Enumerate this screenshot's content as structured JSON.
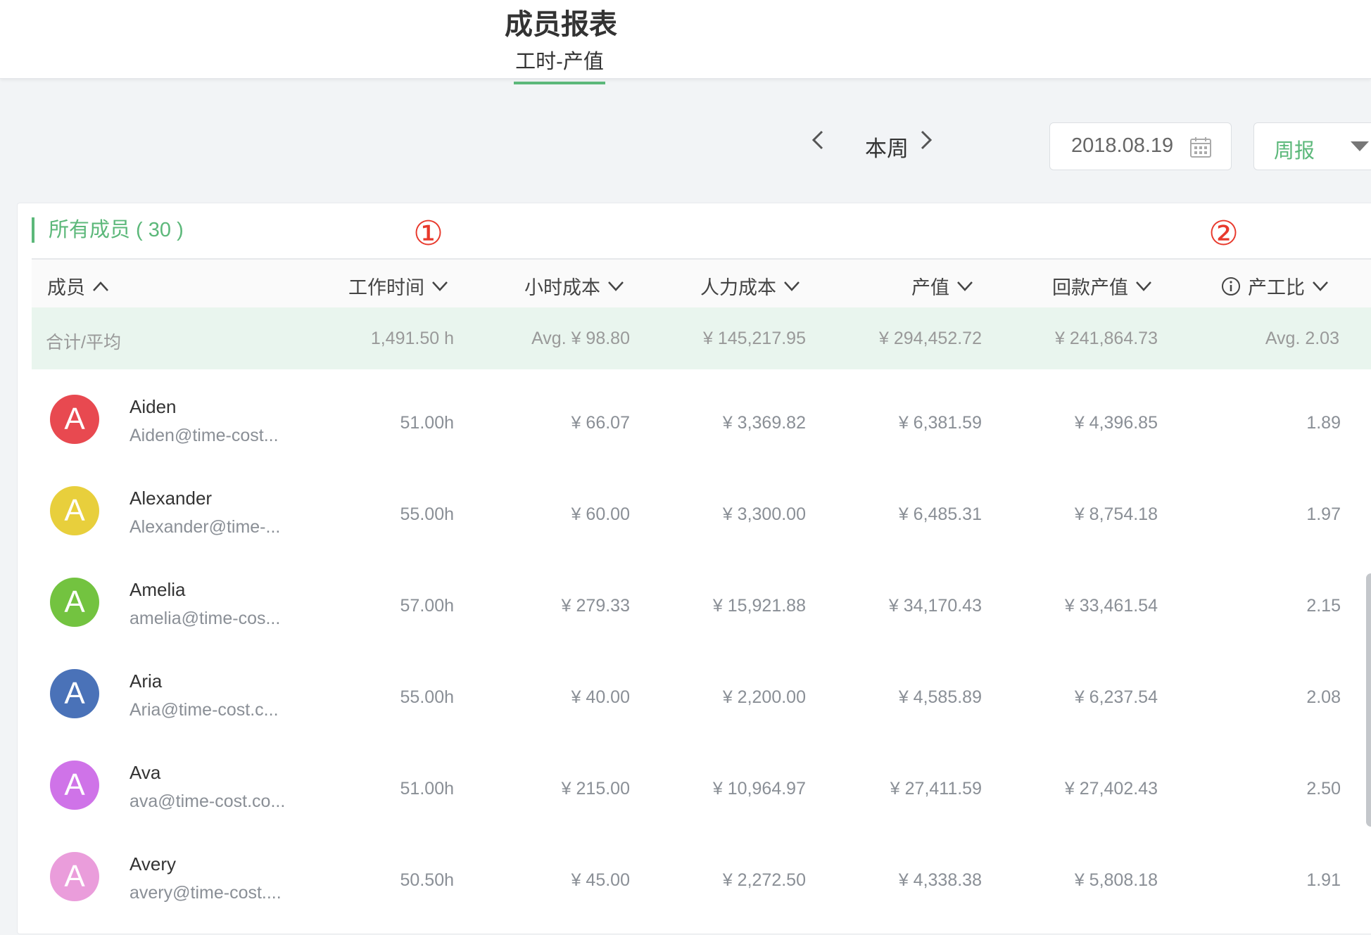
{
  "page": {
    "title": "成员报表",
    "tab": "工时-产值"
  },
  "toolbar": {
    "period": "本周",
    "date": "2018.08.19",
    "report_type": "周报"
  },
  "card": {
    "title": "所有成员 ( 30 )"
  },
  "annotations": [
    "①",
    "②"
  ],
  "columns": [
    "成员",
    "工作时间",
    "小时成本",
    "人力成本",
    "产值",
    "回款产值",
    "产工比"
  ],
  "summary": {
    "label": "合计/平均",
    "hours": "1,491.50 h",
    "hourly_cost": "Avg. ¥ 98.80",
    "labor_cost": "¥ 145,217.95",
    "output": "¥ 294,452.72",
    "collected_output": "¥ 241,864.73",
    "ratio": "Avg. 2.03"
  },
  "members": [
    {
      "initial": "A",
      "color": "#e84950",
      "name": "Aiden",
      "email": "Aiden@time-cost...",
      "hours": "51.00h",
      "hourly_cost": "¥ 66.07",
      "labor_cost": "¥ 3,369.82",
      "output": "¥ 6,381.59",
      "collected_output": "¥ 4,396.85",
      "ratio": "1.89"
    },
    {
      "initial": "A",
      "color": "#e8cf3c",
      "name": "Alexander",
      "email": "Alexander@time-...",
      "hours": "55.00h",
      "hourly_cost": "¥ 60.00",
      "labor_cost": "¥ 3,300.00",
      "output": "¥ 6,485.31",
      "collected_output": "¥ 8,754.18",
      "ratio": "1.97"
    },
    {
      "initial": "A",
      "color": "#73c340",
      "name": "Amelia",
      "email": "amelia@time-cos...",
      "hours": "57.00h",
      "hourly_cost": "¥ 279.33",
      "labor_cost": "¥ 15,921.88",
      "output": "¥ 34,170.43",
      "collected_output": "¥ 33,461.54",
      "ratio": "2.15"
    },
    {
      "initial": "A",
      "color": "#4a72b8",
      "name": "Aria",
      "email": "Aria@time-cost.c...",
      "hours": "55.00h",
      "hourly_cost": "¥ 40.00",
      "labor_cost": "¥ 2,200.00",
      "output": "¥ 4,585.89",
      "collected_output": "¥ 6,237.54",
      "ratio": "2.08"
    },
    {
      "initial": "A",
      "color": "#cf73e8",
      "name": "Ava",
      "email": "ava@time-cost.co...",
      "hours": "51.00h",
      "hourly_cost": "¥ 215.00",
      "labor_cost": "¥ 10,964.97",
      "output": "¥ 27,411.59",
      "collected_output": "¥ 27,402.43",
      "ratio": "2.50"
    },
    {
      "initial": "A",
      "color": "#ea9ddb",
      "name": "Avery",
      "email": "avery@time-cost....",
      "hours": "50.50h",
      "hourly_cost": "¥ 45.00",
      "labor_cost": "¥ 2,272.50",
      "output": "¥ 4,338.38",
      "collected_output": "¥ 5,808.18",
      "ratio": "1.91"
    }
  ]
}
